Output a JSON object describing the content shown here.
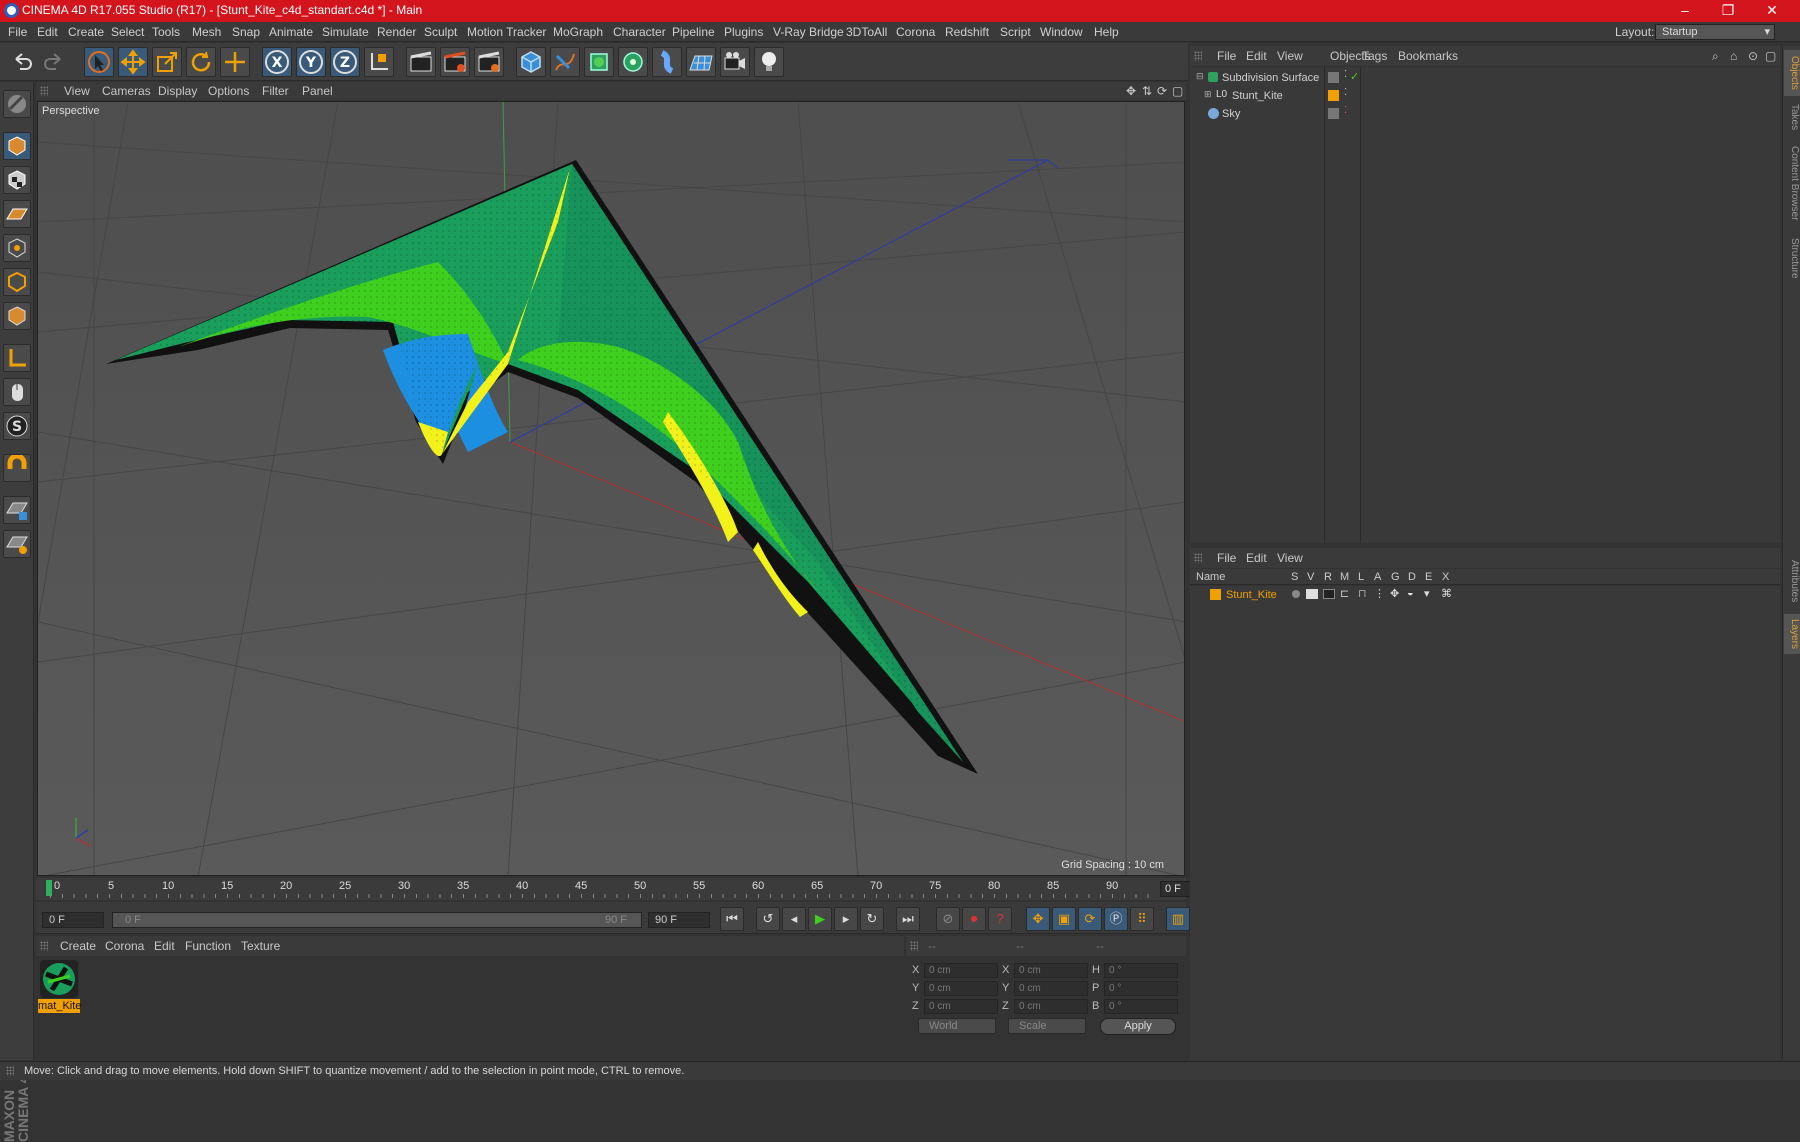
{
  "window": {
    "title": "CINEMA 4D R17.055 Studio (R17) - [Stunt_Kite_c4d_standart.c4d *] - Main",
    "minimize": "–",
    "maximize": "❐",
    "close": "✕"
  },
  "menubar": {
    "items": [
      "File",
      "Edit",
      "Create",
      "Select",
      "Tools",
      "Mesh",
      "Snap",
      "Animate",
      "Simulate",
      "Render",
      "Sculpt",
      "Motion Tracker",
      "MoGraph",
      "Character",
      "Pipeline",
      "Plugins",
      "V-Ray Bridge",
      "3DToAll",
      "Corona",
      "Redshift",
      "Script",
      "Window",
      "Help"
    ],
    "layout_label": "Layout:",
    "layout_value": "Startup"
  },
  "viewport": {
    "menu": [
      "View",
      "Cameras",
      "Display",
      "Options",
      "Filter",
      "Panel"
    ],
    "camera_label": "Perspective",
    "grid_spacing": "Grid Spacing : 10 cm"
  },
  "timeline": {
    "ticks": [
      "0",
      "5",
      "10",
      "15",
      "20",
      "25",
      "30",
      "35",
      "40",
      "45",
      "50",
      "55",
      "60",
      "65",
      "70",
      "75",
      "80",
      "85",
      "90"
    ],
    "current_frame": "0 F",
    "start_field": "0 F",
    "range_start": "0 F",
    "range_end": "90 F",
    "end_field": "90 F"
  },
  "material_manager": {
    "menu": [
      "Create",
      "Corona",
      "Edit",
      "Function",
      "Texture"
    ],
    "materials": [
      {
        "name": "mat_Kite"
      }
    ]
  },
  "coordinates": {
    "headers": [
      "--",
      "--",
      "--"
    ],
    "rows": [
      {
        "a": "X",
        "av": "0 cm",
        "b": "X",
        "bv": "0 cm",
        "c": "H",
        "cv": "0 °"
      },
      {
        "a": "Y",
        "av": "0 cm",
        "b": "Y",
        "bv": "0 cm",
        "c": "P",
        "cv": "0 °"
      },
      {
        "a": "Z",
        "av": "0 cm",
        "b": "Z",
        "bv": "0 cm",
        "c": "B",
        "cv": "0 °"
      }
    ],
    "world": "World",
    "scale": "Scale",
    "apply": "Apply"
  },
  "object_manager": {
    "menu": [
      "File",
      "Edit",
      "View",
      "Objects",
      "Tags",
      "Bookmarks"
    ],
    "objects": [
      {
        "name": "Subdivision Surface"
      },
      {
        "name": "Stunt_Kite"
      },
      {
        "name": "Sky"
      }
    ]
  },
  "layer_manager": {
    "menu": [
      "File",
      "Edit",
      "View"
    ],
    "columns": [
      "Name",
      "S",
      "V",
      "R",
      "M",
      "L",
      "A",
      "G",
      "D",
      "E",
      "X"
    ],
    "layers": [
      {
        "name": "Stunt_Kite"
      }
    ]
  },
  "right_tabs": [
    "Objects",
    "Takes",
    "Content Browser",
    "Structure",
    "Attributes",
    "Layers"
  ],
  "statusbar": {
    "text": "Move: Click and drag to move elements. Hold down SHIFT to quantize movement / add to the selection in point mode, CTRL to remove."
  },
  "colors": {
    "titlebar": "#d4141c",
    "accent_orange": "#f0a000",
    "kite_green": "#1a9e5c",
    "kite_lime": "#3fcf1f",
    "kite_blue": "#1c8fe0",
    "kite_yellow": "#f2f21a"
  }
}
